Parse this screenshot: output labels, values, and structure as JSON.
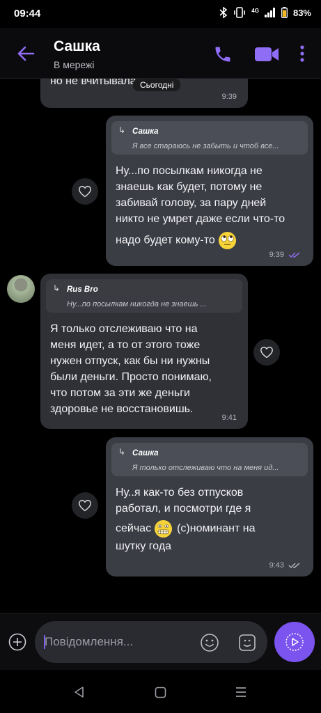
{
  "status": {
    "time": "09:44",
    "network": "4G",
    "battery": "83%"
  },
  "header": {
    "title": "Сашка",
    "subtitle": "В мережі",
    "accent": "#7b53ef"
  },
  "chat": {
    "day_label": "Сьогодні",
    "top_partial": {
      "text": "но не вчитывалась",
      "time": "9:39"
    },
    "messages": [
      {
        "quote_name": "Сашка",
        "quote_text": "Я все стараюсь не забыть и чтоб все...",
        "line1": "Ну...по посылкам никогда не",
        "line2": "знаешь как будет, потому не",
        "line3": "забивай голову, за пару дней",
        "line4": "никто не умрет даже если что-то",
        "line5": "надо будет кому-то",
        "time": "9:39",
        "emoji": "rolling-eyes-emoji"
      },
      {
        "quote_name": "Rus Bro",
        "quote_text": "Ну...по посылкам никогда не знаешь ...",
        "line1": "Я только отслеживаю что на",
        "line2": "меня идет, а то от этого тоже",
        "line3": "нужен отпуск, как бы ни нужны",
        "line4": "были деньги. Просто понимаю,",
        "line5": "что потом за эти же деньги",
        "line6": "здоровье не восстановишь.",
        "time": "9:41"
      },
      {
        "quote_name": "Сашка",
        "quote_text": "Я только отслеживаю что на меня ид...",
        "line1": "Ну..я как-то без отпусков",
        "line2": "работал, и посмотри где я",
        "line3a": "сейчас",
        "line3b": "(с)номинант на",
        "line4": "шутку года",
        "time": "9:43",
        "emoji": "grimacing-emoji"
      }
    ]
  },
  "composer": {
    "placeholder": "Повідомлення..."
  }
}
